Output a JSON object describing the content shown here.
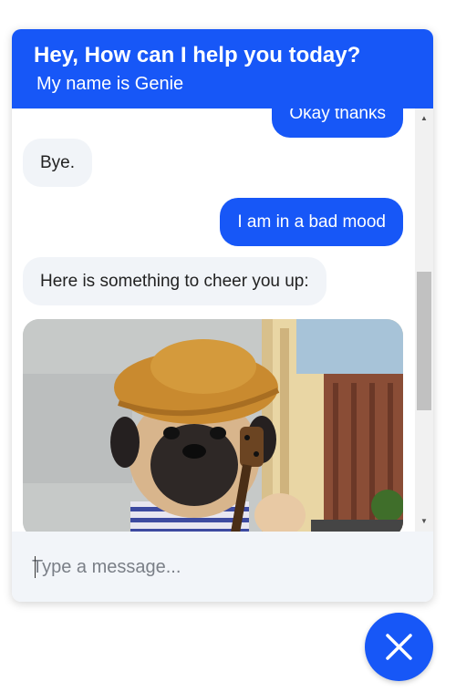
{
  "header": {
    "title": "Hey, How can I help you today?",
    "subtitle": "My name is Genie"
  },
  "messages": [
    {
      "sender": "user",
      "text": "Okay thanks"
    },
    {
      "sender": "bot",
      "text": "Bye."
    },
    {
      "sender": "user",
      "text": "I am in a bad mood"
    },
    {
      "sender": "bot",
      "text": "Here is something to cheer you up:"
    },
    {
      "sender": "bot",
      "type": "image",
      "image": "pug-with-hat-and-ukulele"
    }
  ],
  "input": {
    "placeholder": "Type a message...",
    "value": ""
  },
  "close_button": {
    "icon": "close-icon"
  },
  "colors": {
    "accent": "#1757f7",
    "bot_bubble": "#f1f4f8",
    "input_bar": "#f2f5f9"
  }
}
